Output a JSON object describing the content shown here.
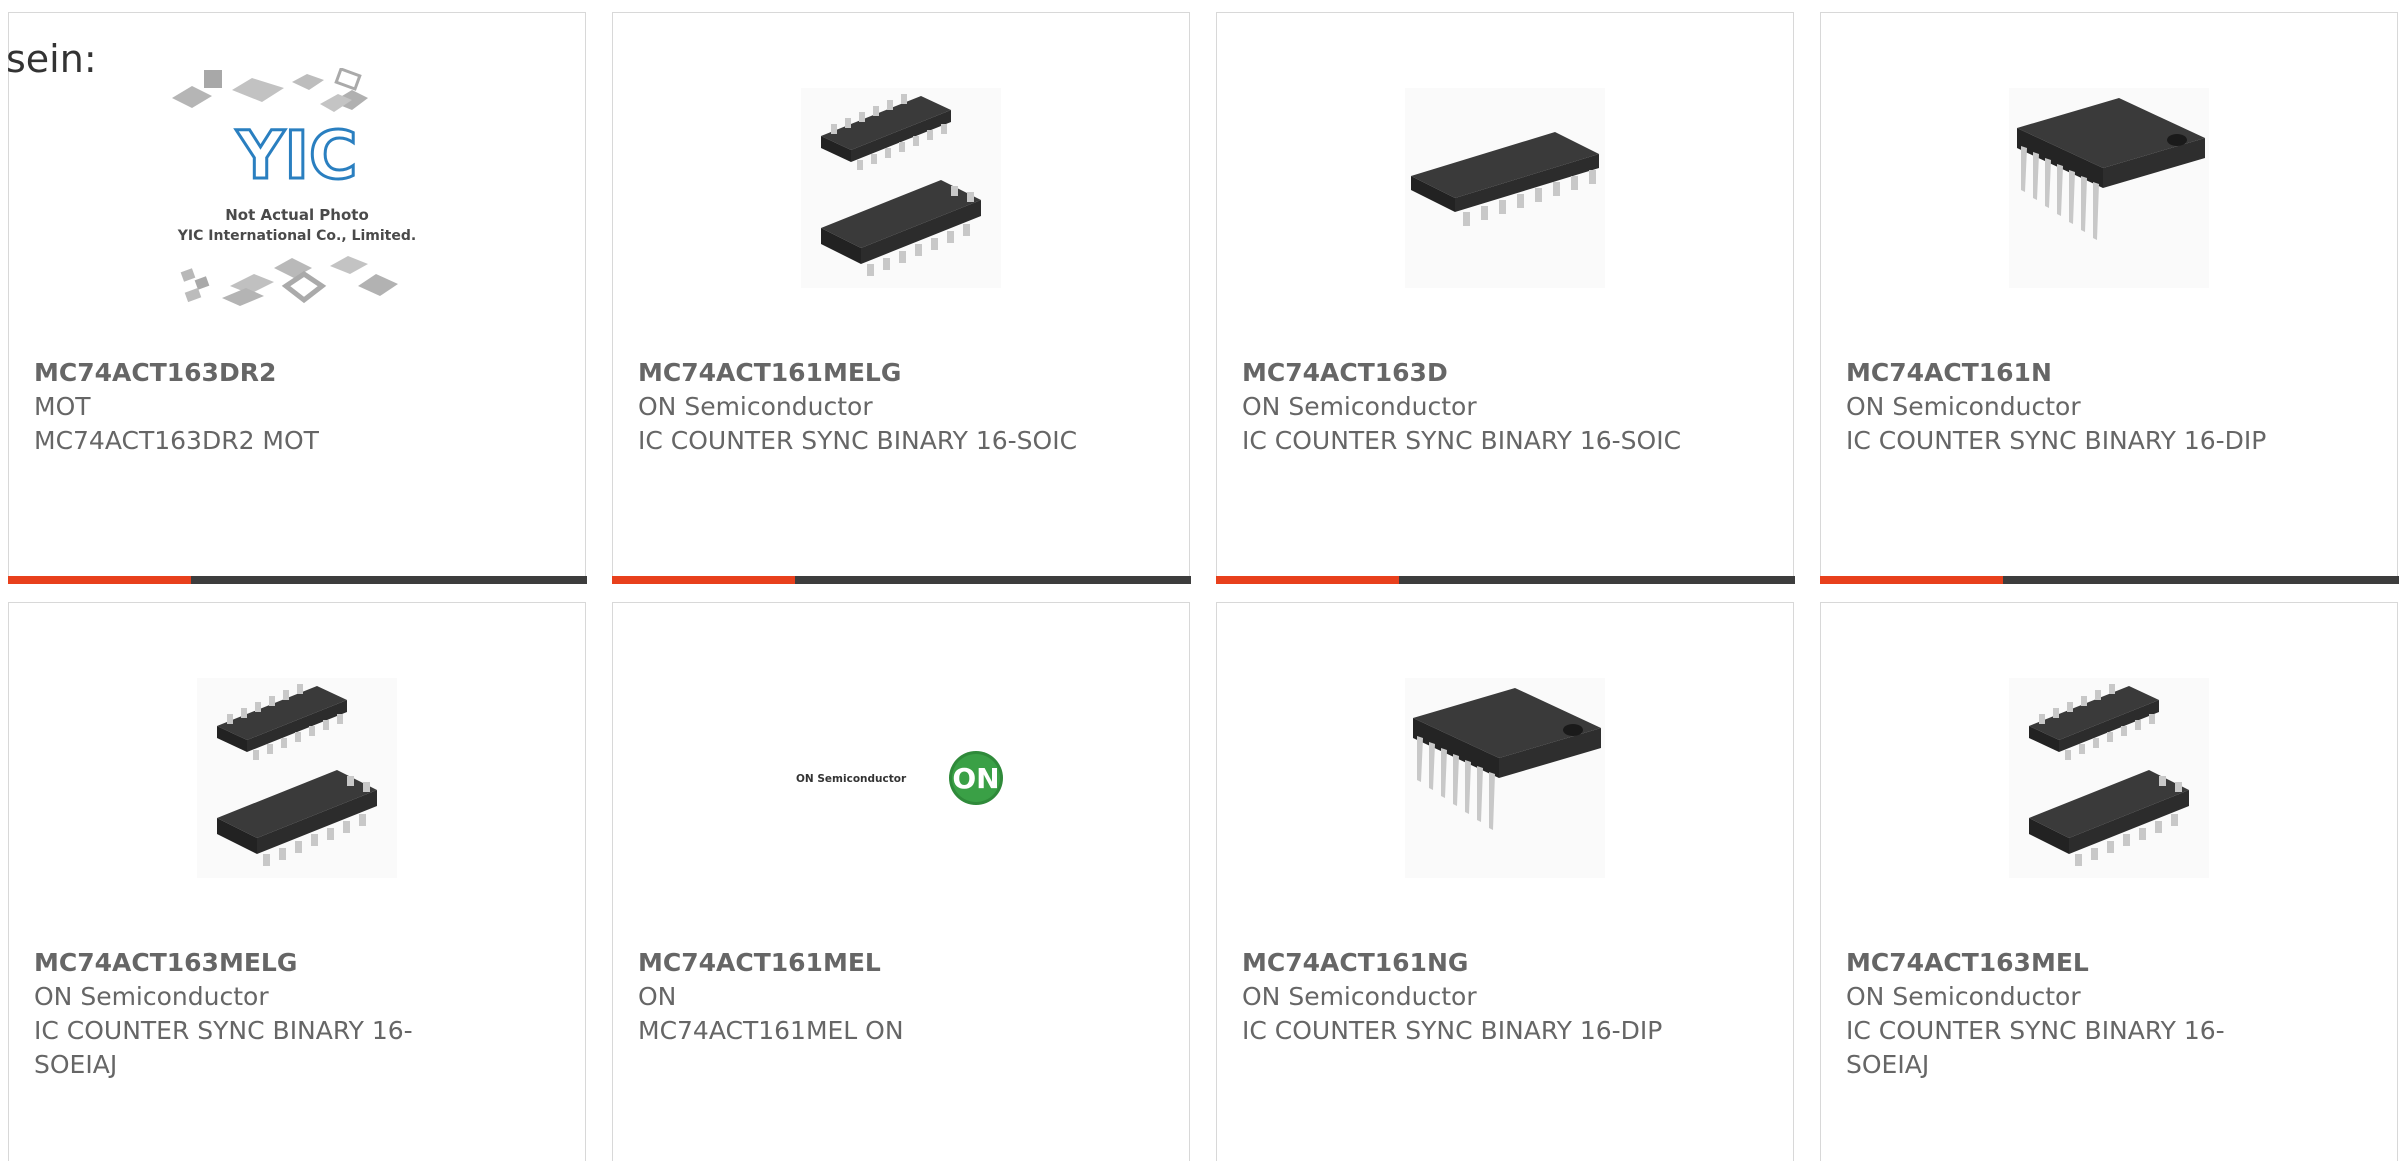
{
  "lead_text": "sein:",
  "products": [
    {
      "part_number": "MC74ACT163DR2",
      "manufacturer": "MOT",
      "description": "MC74ACT163DR2 MOT",
      "image": "placeholder",
      "placeholder": {
        "logo_text": "YIC",
        "line1": "Not Actual Photo",
        "line2": "YIC International Co., Limited."
      }
    },
    {
      "part_number": "MC74ACT161MELG",
      "manufacturer": "ON Semiconductor",
      "description": "IC COUNTER SYNC BINARY 16-SOIC",
      "image": "soic-pair"
    },
    {
      "part_number": "MC74ACT163D",
      "manufacturer": "ON Semiconductor",
      "description": "IC COUNTER SYNC BINARY 16-SOIC",
      "image": "soic-single"
    },
    {
      "part_number": "MC74ACT161N",
      "manufacturer": "ON Semiconductor",
      "description": "IC COUNTER SYNC BINARY 16-DIP",
      "image": "dip"
    },
    {
      "part_number": "MC74ACT163MELG",
      "manufacturer": "ON Semiconductor",
      "description": "IC COUNTER SYNC BINARY 16-SOEIAJ",
      "image": "soic-pair"
    },
    {
      "part_number": "MC74ACT161MEL",
      "manufacturer": "ON",
      "description": "MC74ACT161MEL ON",
      "image": "on-logo",
      "logo": {
        "text": "ON Semiconductor",
        "mark": "ON"
      }
    },
    {
      "part_number": "MC74ACT161NG",
      "manufacturer": "ON Semiconductor",
      "description": "IC COUNTER SYNC BINARY 16-DIP",
      "image": "dip"
    },
    {
      "part_number": "MC74ACT163MEL",
      "manufacturer": "ON Semiconductor",
      "description": "IC COUNTER SYNC BINARY 16-SOEIAJ",
      "image": "soic-pair"
    }
  ],
  "colors": {
    "accent": "#e8401c",
    "bar": "#3d3d3d",
    "text": "#666666",
    "border": "#d8d8d8",
    "on_logo_green": "#2f8a3a"
  }
}
